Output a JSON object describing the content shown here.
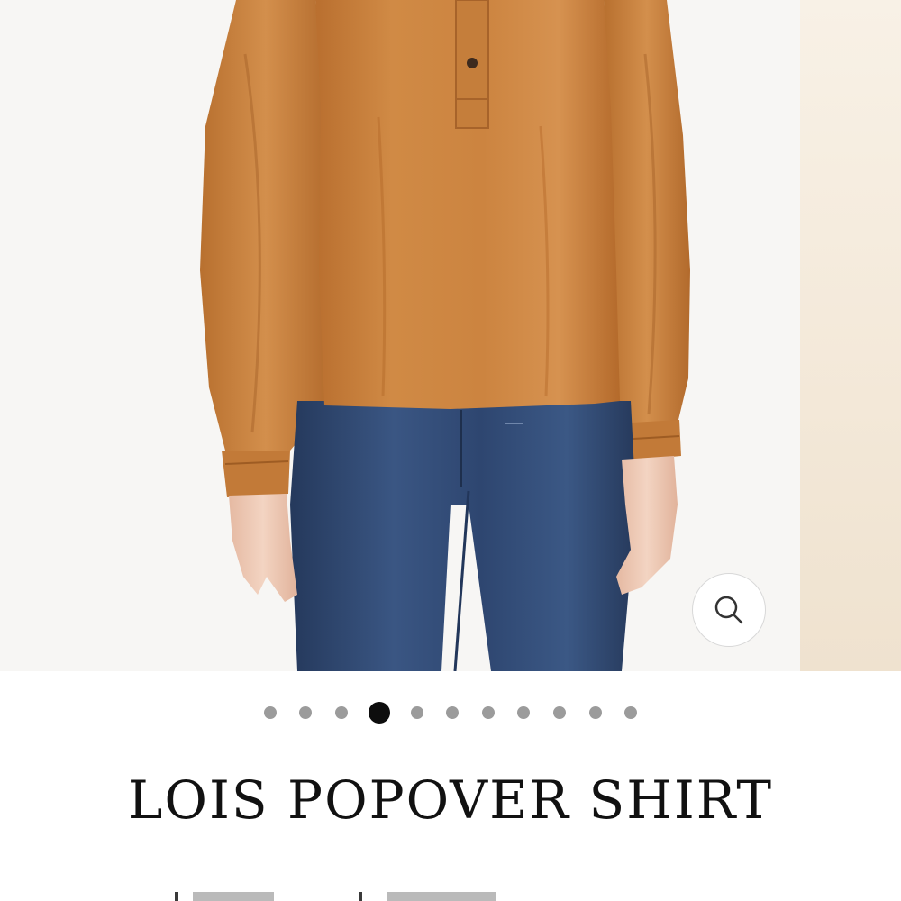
{
  "gallery": {
    "image_description_icon": "model-wearing-orange-blouse-and-jeans",
    "colors": {
      "blouse": "#c9803b",
      "jeans": "#2f4a72",
      "skin": "#f0cdb8",
      "background": "#f7f6f4"
    },
    "zoom_icon": "magnifier-icon"
  },
  "pagination": {
    "total": 11,
    "active_index": 3
  },
  "product": {
    "title": "LOIS POPOVER SHIRT"
  }
}
